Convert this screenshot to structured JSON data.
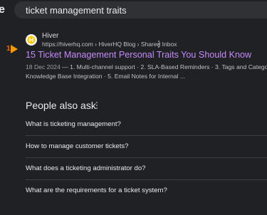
{
  "search": {
    "logo_fragment": "e",
    "query": "ticket management traits"
  },
  "result": {
    "marker_number": "1",
    "site_name": "Hiver",
    "site_url": "https://hiverhq.com › HiverHQ Blog › Shared Inbox",
    "title": "15 Ticket Management Personal Traits You Should Know",
    "date": "18 Dec 2024",
    "snippet_line1": " — 1. Multi-channel support · 2. SLA-Based Reminders · 3. Tags and Categories ·",
    "snippet_line2": "Knowledge Base Integration · 5. Email Notes for Internal ...",
    "marker_color": "#ff9800",
    "title_color": "#c58af9"
  },
  "people_also_ask": {
    "title": "People also ask",
    "questions": [
      "What is ticketing management?",
      "How to manage customer tickets?",
      "What does a ticketing administrator do?",
      "What are the requirements for a ticket system?"
    ]
  },
  "icons": {
    "site_favicon": "hiver-favicon-icon",
    "result_menu": "more-vert-icon",
    "paa_menu": "more-vert-icon",
    "marker": "play-arrow-icon"
  }
}
